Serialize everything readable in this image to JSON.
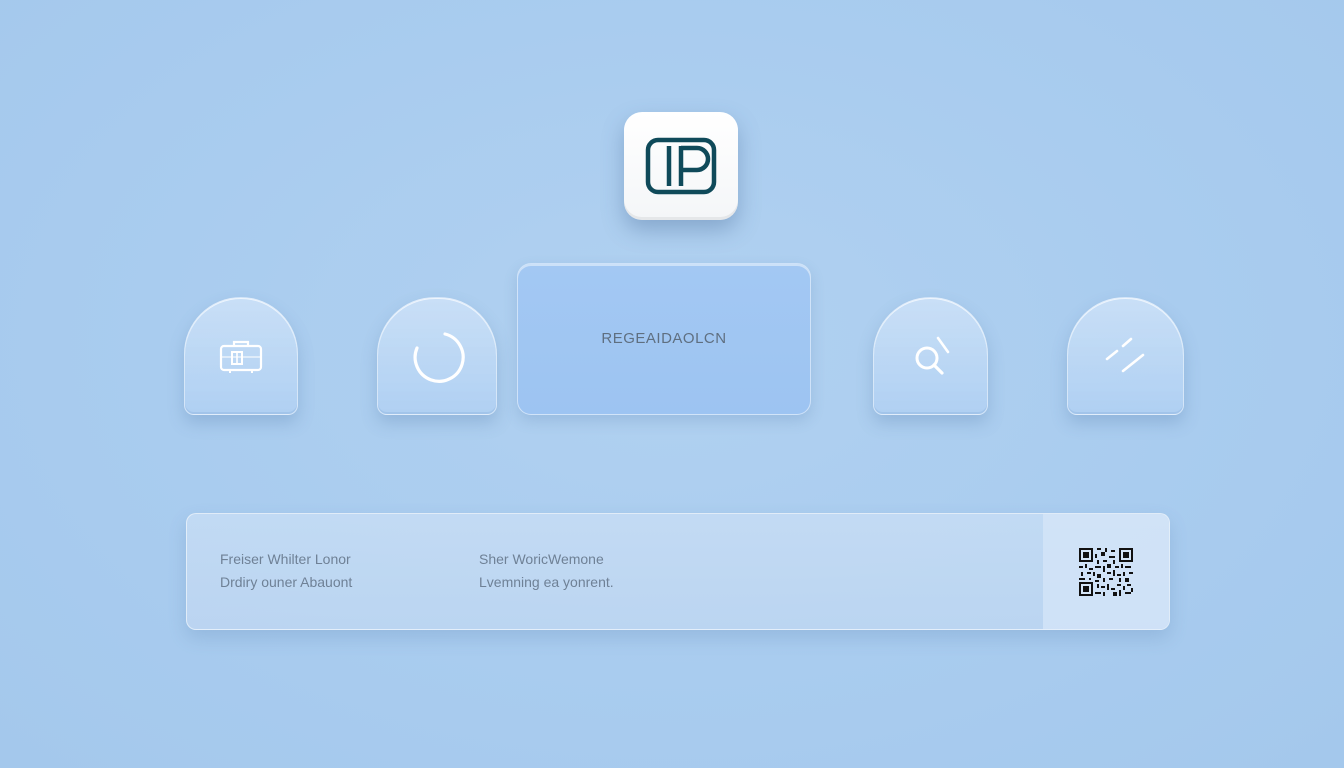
{
  "logo": {
    "icon": "op-logo-icon"
  },
  "toolbar": {
    "tools": [
      {
        "icon": "briefcase-icon"
      },
      {
        "icon": "loading-ring-icon"
      },
      {
        "icon": "search-icon"
      },
      {
        "icon": "slash-dash-icon"
      }
    ],
    "primary_label": "REGEAIDAOLCN"
  },
  "info_card": {
    "col1": [
      "Freiser Whilter Lonor",
      "Drdiry ouner Abauont"
    ],
    "col2": [
      "Sher WoricWemone",
      "Lvemning ea yonrent."
    ],
    "qr_icon": "qr-code-icon"
  },
  "colors": {
    "background": "#a9ccef",
    "logo_teal": "#0f4a5a",
    "panel": "#9dc4f2"
  }
}
